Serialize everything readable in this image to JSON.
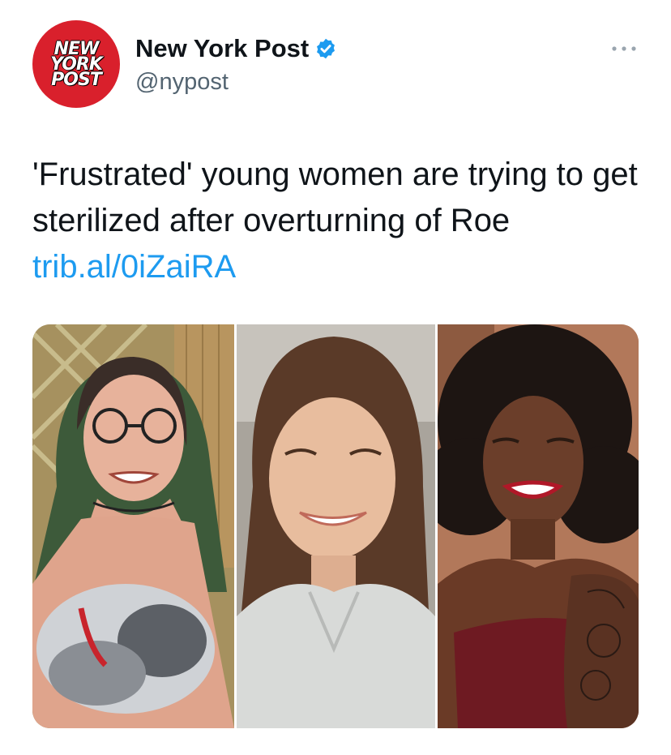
{
  "account": {
    "name": "New York Post",
    "handle": "@nypost",
    "logo_lines": [
      "NEW",
      "YORK",
      "POST"
    ],
    "verified": true,
    "avatar_color": "#d9202c"
  },
  "tweet": {
    "text": "'Frustrated' young women are trying to get sterilized after overturning of Roe ",
    "link": "trib.al/0iZaiRA",
    "link_color": "#1d9bf0"
  },
  "icons": {
    "more": "more-options-icon",
    "verified": "verified-badge-icon"
  }
}
